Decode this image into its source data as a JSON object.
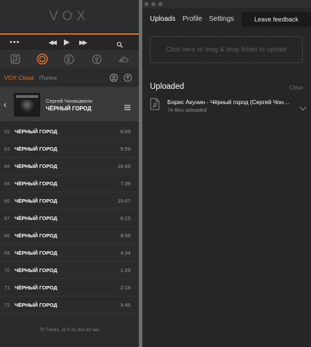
{
  "vox": {
    "logo": "VOX",
    "controls": {
      "more": "•••"
    },
    "tabs": {
      "vox_cloud": "VOX Cloud",
      "itunes": "iTunes"
    },
    "album": {
      "artist": "Сергей Чонишвили",
      "title": "ЧЁРНЫЙ ГОРОД"
    },
    "tracks": [
      {
        "num": "62",
        "title": "ЧЁРНЫЙ ГОРОД",
        "duration": "6:09"
      },
      {
        "num": "63",
        "title": "ЧЁРНЫЙ ГОРОД",
        "duration": "5:59"
      },
      {
        "num": "64",
        "title": "ЧЁРНЫЙ ГОРОД",
        "duration": "16:49"
      },
      {
        "num": "65",
        "title": "ЧЁРНЫЙ ГОРОД",
        "duration": "7:39"
      },
      {
        "num": "66",
        "title": "ЧЁРНЫЙ ГОРОД",
        "duration": "10:47"
      },
      {
        "num": "67",
        "title": "ЧЁРНЫЙ ГОРОД",
        "duration": "6:15"
      },
      {
        "num": "68",
        "title": "ЧЁРНЫЙ ГОРОД",
        "duration": "8:56"
      },
      {
        "num": "69",
        "title": "ЧЁРНЫЙ ГОРОД",
        "duration": "4:34"
      },
      {
        "num": "70",
        "title": "ЧЁРНЫЙ ГОРОД",
        "duration": "1:29"
      },
      {
        "num": "71",
        "title": "ЧЁРНЫЙ ГОРОД",
        "duration": "2:18"
      },
      {
        "num": "72",
        "title": "ЧЁРНЫЙ ГОРОД",
        "duration": "9:46"
      }
    ],
    "footer": "72 Tracks, 11 h 21 min 32 sec",
    "accent_color": "#e8721c"
  },
  "uploader": {
    "nav": {
      "uploads": "Uploads",
      "profile": "Profile",
      "settings": "Settings"
    },
    "feedback_label": "Leave feedback",
    "dropzone_text": "Click here or drag & drop folder to upload",
    "uploaded_title": "Uploaded",
    "clear_label": "Clear",
    "item": {
      "name": "Борис Акунин - Чёрный город (Сергей Чонишвили)",
      "status": "74 files uploaded"
    }
  }
}
